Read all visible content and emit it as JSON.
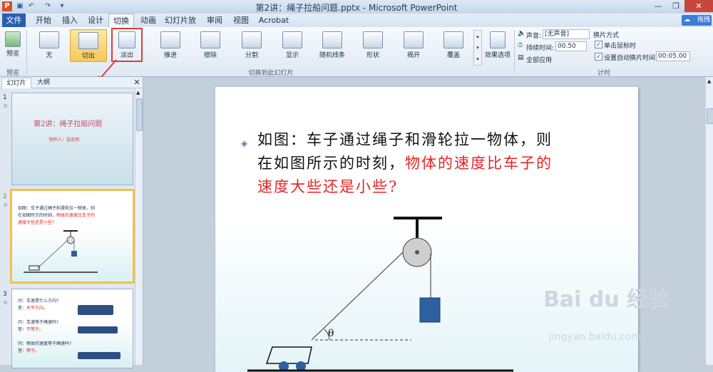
{
  "window": {
    "title": "第2讲：绳子拉船问题.pptx - Microsoft PowerPoint"
  },
  "qa_icons": [
    "save-icon",
    "undo-icon",
    "redo-icon",
    "customize-icon"
  ],
  "tabs": [
    "文件",
    "开始",
    "插入",
    "设计",
    "切换",
    "动画",
    "幻灯片放映",
    "审阅",
    "视图",
    "Acrobat"
  ],
  "ribbon": {
    "preview": {
      "label": "预览",
      "group": "预览"
    },
    "transitions": [
      "无",
      "切出",
      "淡出",
      "推进",
      "擦除",
      "分割",
      "显示",
      "随机线条",
      "形状",
      "揭开",
      "覆盖"
    ],
    "effect_options": "效果选项",
    "group_transitions": "切换到此幻灯片",
    "timing": {
      "sound_label": "声音:",
      "sound_value": "[无声音]",
      "duration_label": "持续时间:",
      "duration_value": "00.50",
      "apply_all": "全部应用",
      "advance_title": "换片方式",
      "on_click": "单击鼠标时",
      "after_label": "设置自动换片时间:",
      "after_value": "00:05.00",
      "group": "计时"
    },
    "sign_in": "拖拽"
  },
  "panel": {
    "tab_slides": "幻灯片",
    "tab_outline": "大纲",
    "slide1": {
      "num": "1",
      "title": "第2讲：绳子拉船问题",
      "author": "制作人：张克明"
    },
    "slide2": {
      "num": "2",
      "line1": "如图：车子通过绳子和滑轮拉一物体，则",
      "line2": "在如图所示的时刻，",
      "line2_red": "物体的速度比车子的",
      "line3_red": "速度大些还是小些?"
    },
    "slide3": {
      "num": "3",
      "q1": "问：车速是什么方向?",
      "a1_label": "答：",
      "a1": "水平方向。",
      "q2": "问：车速等于绳速吗?",
      "a2_label": "答：",
      "a2": "不等于。",
      "q3": "问：物体的速度等于绳速吗?",
      "a3_label": "答：",
      "a3": "等于。"
    }
  },
  "slide": {
    "bullet": "◈",
    "line1": "如图：车子通过绳子和滑轮拉一物体，则",
    "line2_black": "在如图所示的时刻，",
    "line2_red": "物体的速度比车子的",
    "line3_red": "速度大些还是小些?",
    "theta": "θ"
  },
  "watermark": {
    "main": "Bai du 经验",
    "sub": "jingyan.baidu.com"
  },
  "colors": {
    "accent": "#2a5fb0",
    "highlight_red": "#e23a3a",
    "text_red": "#e52424"
  }
}
